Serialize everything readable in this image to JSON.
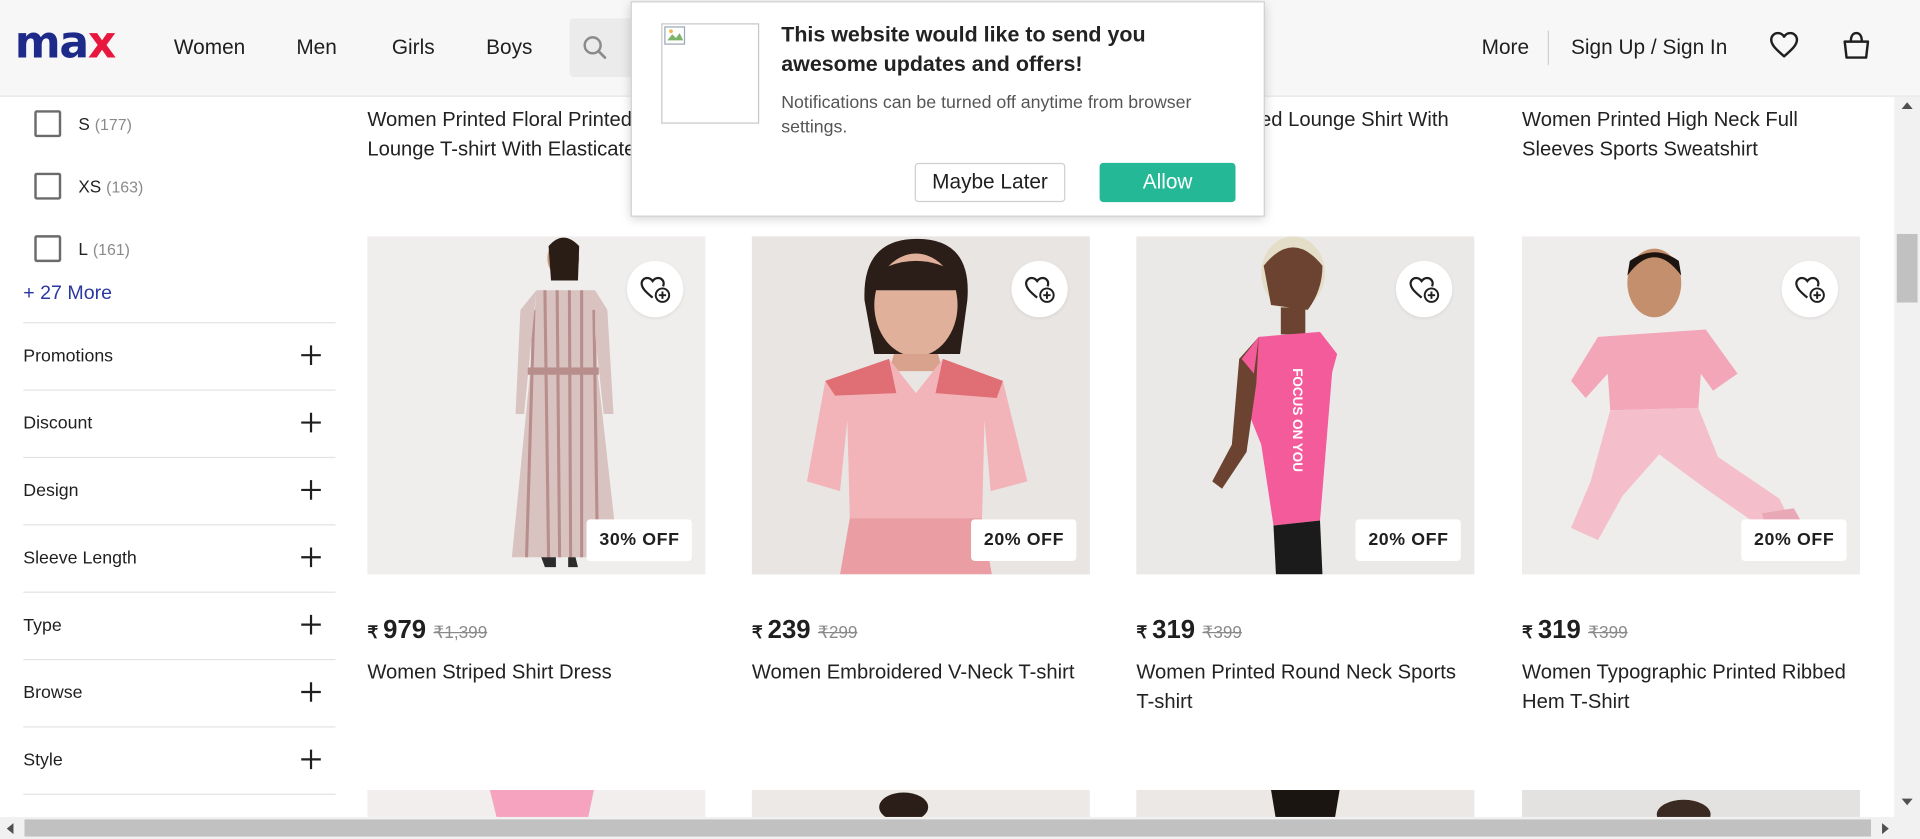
{
  "brand": {
    "logo_left": "ma",
    "logo_right": "x",
    "colors": {
      "logo_blue": "#1e2a8a",
      "logo_red": "#e8173d",
      "accent_green": "#24b896",
      "link_blue": "#2b37a3"
    }
  },
  "nav": {
    "items": [
      "Women",
      "Men",
      "Girls",
      "Boys"
    ],
    "more": "More",
    "signin_a": "Sign Up",
    "signin_sep": "/",
    "signin_b": "Sign In",
    "icons": [
      "search-icon",
      "heart-icon",
      "bag-icon"
    ]
  },
  "sidebar": {
    "sizes": [
      {
        "label": "S",
        "count": "(177)"
      },
      {
        "label": "XS",
        "count": "(163)"
      },
      {
        "label": "L",
        "count": "(161)"
      }
    ],
    "more_link": "+ 27 More",
    "filters": [
      "Promotions",
      "Discount",
      "Design",
      "Sleeve Length",
      "Type",
      "Browse",
      "Style"
    ]
  },
  "top_row_titles": [
    {
      "line1": "Women Printed Floral Printed",
      "line2": "Lounge T-shirt With Elasticated"
    },
    {
      "line1": "",
      "line2": ""
    },
    {
      "line1": "ed Lounge Shirt With",
      "line2": ""
    },
    {
      "line1": "Women Printed High Neck Full",
      "line2": "Sleeves Sports Sweatshirt"
    }
  ],
  "products": [
    {
      "title": "Women Striped Shirt Dress",
      "price": "979",
      "mrp": "₹1,399",
      "discount": "30% OFF"
    },
    {
      "title": "Women Embroidered V-Neck T-shirt",
      "price": "239",
      "mrp": "₹299",
      "discount": "20% OFF"
    },
    {
      "title": "Women Printed Round Neck Sports T-shirt",
      "price": "319",
      "mrp": "₹399",
      "discount": "20% OFF",
      "shirt_print": "FOCUS ON YOU"
    },
    {
      "title": "Women Typographic Printed Ribbed Hem T-Shirt",
      "price": "319",
      "mrp": "₹399",
      "discount": "20% OFF"
    }
  ],
  "currency_symbol": "₹",
  "popup": {
    "title": "This website would like to send you awesome updates and offers!",
    "message": "Notifications can be turned off anytime from browser settings.",
    "later_label": "Maybe Later",
    "allow_label": "Allow"
  }
}
